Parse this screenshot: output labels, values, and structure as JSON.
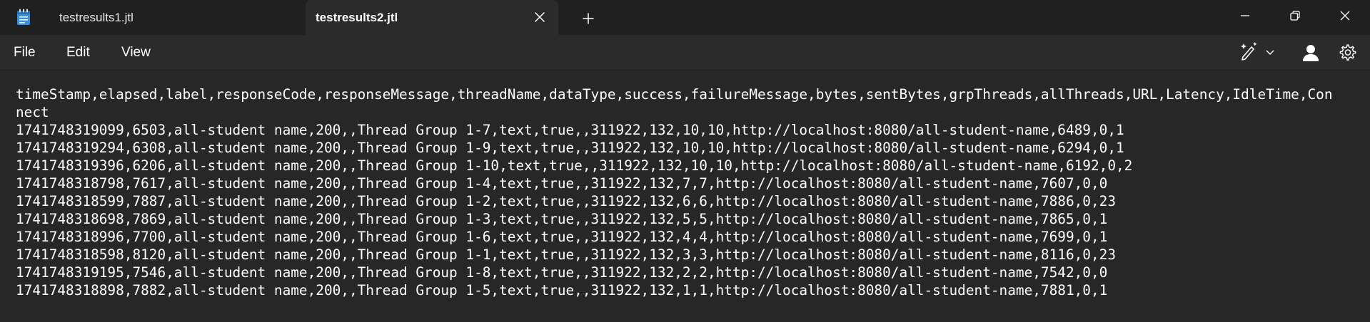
{
  "app": {
    "tabs": [
      {
        "label": "testresults1.jtl",
        "active": false
      },
      {
        "label": "testresults2.jtl",
        "active": true
      }
    ]
  },
  "menu": {
    "file": "File",
    "edit": "Edit",
    "view": "View"
  },
  "icons": {
    "app": "notepad-icon",
    "tab_close": "close-icon",
    "new_tab": "plus-icon",
    "minimize": "minimize-icon",
    "maximize": "restore-icon",
    "close": "close-icon",
    "copilot": "copilot-pen-icon",
    "account": "account-icon",
    "settings": "gear-icon"
  },
  "colors": {
    "titlebar": "#202020",
    "editor_bg": "#272727",
    "text": "#ffffff",
    "accent_icon": "#3a8fd9"
  },
  "editor": {
    "lines": [
      "timeStamp,elapsed,label,responseCode,responseMessage,threadName,dataType,success,failureMessage,bytes,sentBytes,grpThreads,allThreads,URL,Latency,IdleTime,Con",
      "nect",
      "1741748319099,6503,all-student name,200,,Thread Group 1-7,text,true,,311922,132,10,10,http://localhost:8080/all-student-name,6489,0,1",
      "1741748319294,6308,all-student name,200,,Thread Group 1-9,text,true,,311922,132,10,10,http://localhost:8080/all-student-name,6294,0,1",
      "1741748319396,6206,all-student name,200,,Thread Group 1-10,text,true,,311922,132,10,10,http://localhost:8080/all-student-name,6192,0,2",
      "1741748318798,7617,all-student name,200,,Thread Group 1-4,text,true,,311922,132,7,7,http://localhost:8080/all-student-name,7607,0,0",
      "1741748318599,7887,all-student name,200,,Thread Group 1-2,text,true,,311922,132,6,6,http://localhost:8080/all-student-name,7886,0,23",
      "1741748318698,7869,all-student name,200,,Thread Group 1-3,text,true,,311922,132,5,5,http://localhost:8080/all-student-name,7865,0,1",
      "1741748318996,7700,all-student name,200,,Thread Group 1-6,text,true,,311922,132,4,4,http://localhost:8080/all-student-name,7699,0,1",
      "1741748318598,8120,all-student name,200,,Thread Group 1-1,text,true,,311922,132,3,3,http://localhost:8080/all-student-name,8116,0,23",
      "1741748319195,7546,all-student name,200,,Thread Group 1-8,text,true,,311922,132,2,2,http://localhost:8080/all-student-name,7542,0,0",
      "1741748318898,7882,all-student name,200,,Thread Group 1-5,text,true,,311922,132,1,1,http://localhost:8080/all-student-name,7881,0,1"
    ]
  }
}
